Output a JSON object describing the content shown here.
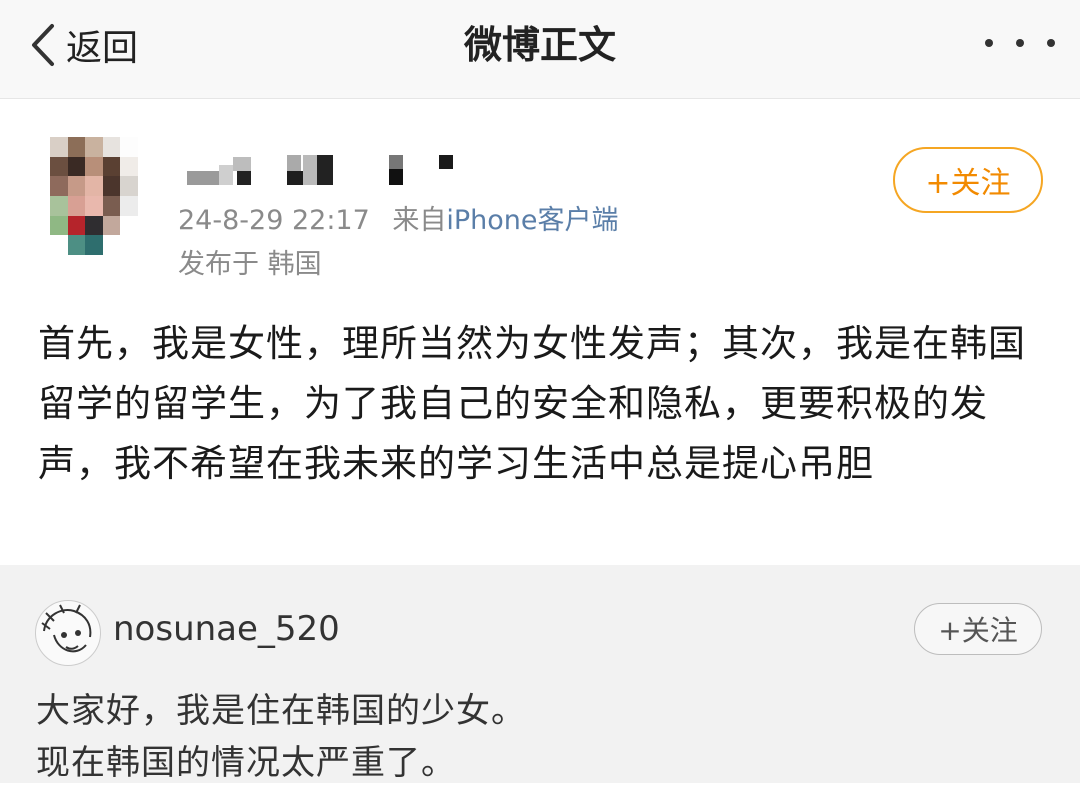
{
  "header": {
    "back_label": "返回",
    "title": "微博正文",
    "back_icon": "chevron-left-icon",
    "more_icon": "more-dots-icon"
  },
  "post": {
    "timestamp": "24-8-29 22:17",
    "source_prefix": "来自",
    "source": "iPhone客户端",
    "location": "发布于 韩国",
    "follow_label": "+关注",
    "follow_color": "#f28a00",
    "body": "首先，我是女性，理所当然为女性发声；其次，我是在韩国留学的留学生，为了我自己的安全和隐私，更要积极的发声，我不希望在我未来的学习生活中总是提心吊胆"
  },
  "repost": {
    "username": "nosunae_520",
    "follow_label": "+关注",
    "lines": [
      "大家好，我是住在韩国的少女。",
      "现在韩国的情况太严重了。"
    ]
  }
}
